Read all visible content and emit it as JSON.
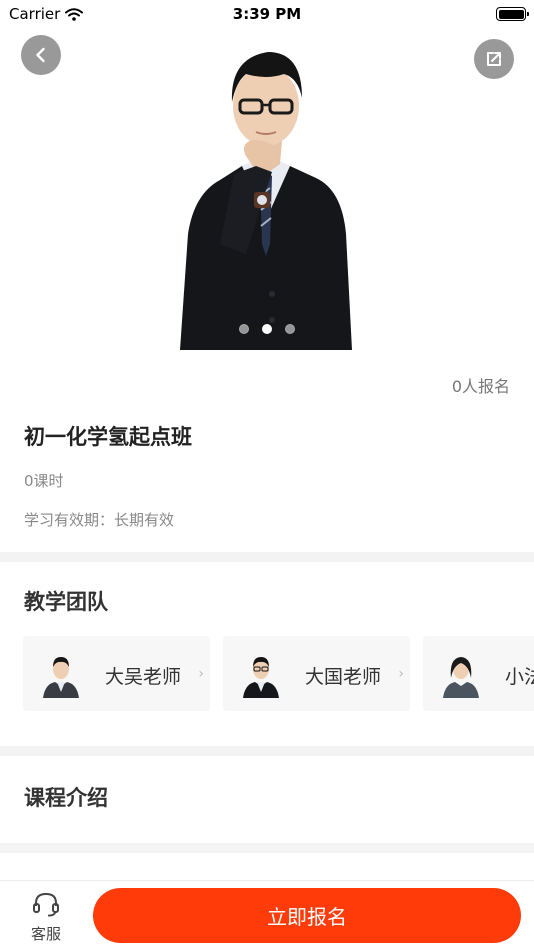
{
  "status_bar": {
    "carrier": "Carrier",
    "time": "3:39 PM"
  },
  "hero": {
    "slides_total": 3,
    "active_slide": 2
  },
  "course": {
    "enroll_count": "0人报名",
    "title": "初一化学氢起点班",
    "lesson_count": "0课时",
    "validity": "学习有效期：长期有效"
  },
  "team": {
    "title": "教学团队",
    "teachers": [
      {
        "name": "大吴老师"
      },
      {
        "name": "大国老师"
      },
      {
        "name": "小法"
      }
    ]
  },
  "intro": {
    "title": "课程介绍"
  },
  "bottom_bar": {
    "service_label": "客服",
    "enroll_button": "立即报名"
  },
  "colors": {
    "accent": "#ff3b0a",
    "divider": "#f3f3f3",
    "card_bg": "#f7f7f7"
  },
  "icons": [
    "wifi-icon",
    "battery-icon",
    "back-arrow-icon",
    "share-icon",
    "headset-icon",
    "chevron-right-icon"
  ]
}
